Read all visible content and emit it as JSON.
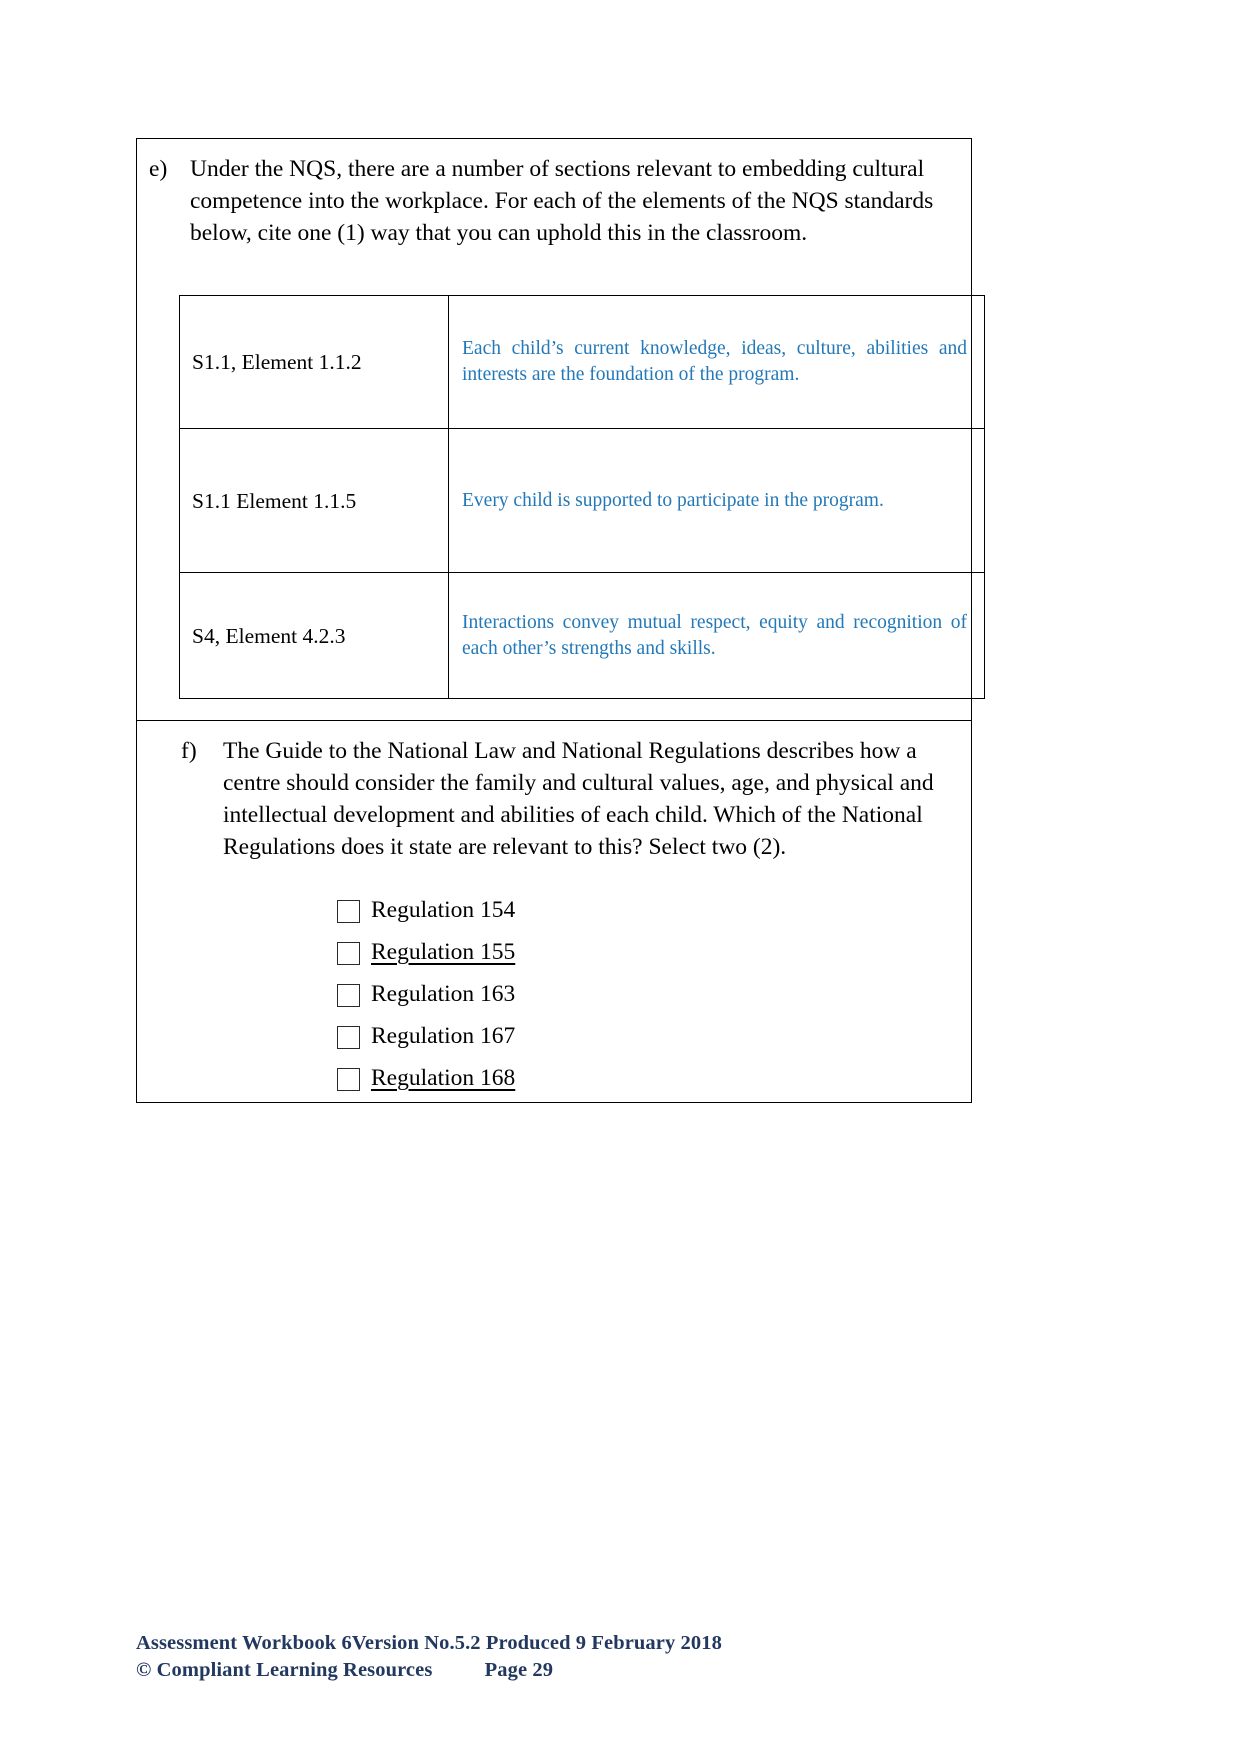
{
  "document": {
    "type": "assessment-workbook-page"
  },
  "colors": {
    "answer_blue": "#2378B8",
    "footer_navy": "#22385F",
    "border_black": "#000000"
  },
  "question_e": {
    "marker": "e)",
    "text": "Under the NQS, there are a number of sections relevant to embedding cultural competence into the workplace. For each of the elements of the NQS standards below, cite one (1) way that you can uphold this in the classroom.",
    "table": {
      "rows": [
        {
          "label": "S1.1, Element 1.1.2",
          "answer": "Each child’s current knowledge, ideas, culture, abilities and interests are the foundation of the program."
        },
        {
          "label": "S1.1 Element 1.1.5",
          "answer": "Every child is supported to participate in the program."
        },
        {
          "label": "S4, Element 4.2.3",
          "answer": "Interactions convey mutual respect, equity and recognition of each other’s strengths and skills."
        }
      ]
    }
  },
  "question_f": {
    "marker": "f)",
    "text": "The Guide to the National Law and National Regulations describes how a centre should consider the family and cultural values, age, and physical and intellectual development and abilities of each child. Which of the National Regulations does it state are relevant to this? Select two (2).",
    "options": [
      {
        "label": "Regulation 154",
        "selected": false
      },
      {
        "label": "Regulation 155",
        "selected": true
      },
      {
        "label": "Regulation 163",
        "selected": false
      },
      {
        "label": "Regulation 167",
        "selected": false
      },
      {
        "label": "Regulation 168",
        "selected": true
      }
    ]
  },
  "footer": {
    "line1": "Assessment Workbook 6Version No.5.2 Produced 9 February 2018",
    "line2": "© Compliant Learning Resources          Page 29"
  }
}
